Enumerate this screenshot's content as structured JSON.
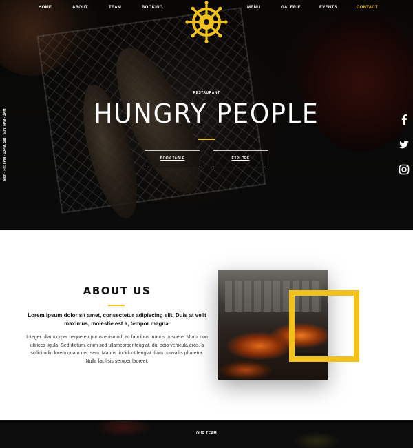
{
  "nav": {
    "home": "HOME",
    "about": "ABOUT",
    "team": "TEAM",
    "booking": "BOOKING",
    "menu": "MENU",
    "galerie": "GALERIE",
    "events": "EVENTS",
    "contact": "CONTACT",
    "active": "CONTACT"
  },
  "logo": {
    "icon": "ship-wheel-icon",
    "color": "#f2c21a"
  },
  "hours": "Mon - Fri: 8PM - 10PM, Sat - Sun: 8PM - 3AM",
  "social": [
    "facebook-icon",
    "twitter-icon",
    "instagram-icon"
  ],
  "hero": {
    "kicker": "RESTAURANT",
    "title": "HUNGRY PEOPLE",
    "buttons": {
      "book": "BOOK TABLE",
      "explore": "EXPLORE"
    }
  },
  "about": {
    "title": "ABOUT US",
    "lead": "Lorem ipsum dolor sit amet, consectetur adipiscing elit. Duis at velit maximus, molestie est a, tempor magna.",
    "body": "Integer ullamcorper neque eu purus euismod, ac faucibus mauris posuere. Morbi non ultrices ligula. Sed dictum, enim sed ullamcorper feugiat, dui odio vehicula eros, a sollicitudin lorem quam nec sem. Mauris tincidunt feugiat diam convallis pharetra. Nulla facilisis semper laoreet."
  },
  "team": {
    "label": "OUR TEAM"
  },
  "colors": {
    "accent": "#f2c21a",
    "dark": "#0a0a0a",
    "light": "#ffffff"
  }
}
